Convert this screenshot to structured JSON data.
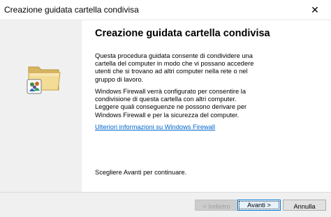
{
  "window": {
    "title": "Creazione guidata cartella condivisa",
    "close_glyph": "✕"
  },
  "content": {
    "heading": "Creazione guidata cartella condivisa",
    "paragraph1": "Questa procedura guidata consente di condividere una cartella del computer in modo che vi possano accedere utenti che si trovano ad altri computer nella rete o nel gruppo di lavoro.",
    "paragraph2": "Windows Firewall verrà configurato per consentire la condivisione di questa cartella con altri computer. Leggere quali conseguenze ne possono derivare per Windows Firewall e per la sicurezza del computer.",
    "link": "Ulteriori informazioni su Windows Firewall",
    "continue_text": "Scegliere Avanti per continuare."
  },
  "buttons": {
    "back": "< Indietro",
    "next": "Avanti >",
    "cancel": "Annulla"
  },
  "icons": {
    "wizard": "shared-folder-users-icon",
    "close": "close-icon"
  },
  "colors": {
    "link": "#0066cc",
    "sidebar": "#f0f0f0",
    "focus_border": "#0078d7"
  }
}
